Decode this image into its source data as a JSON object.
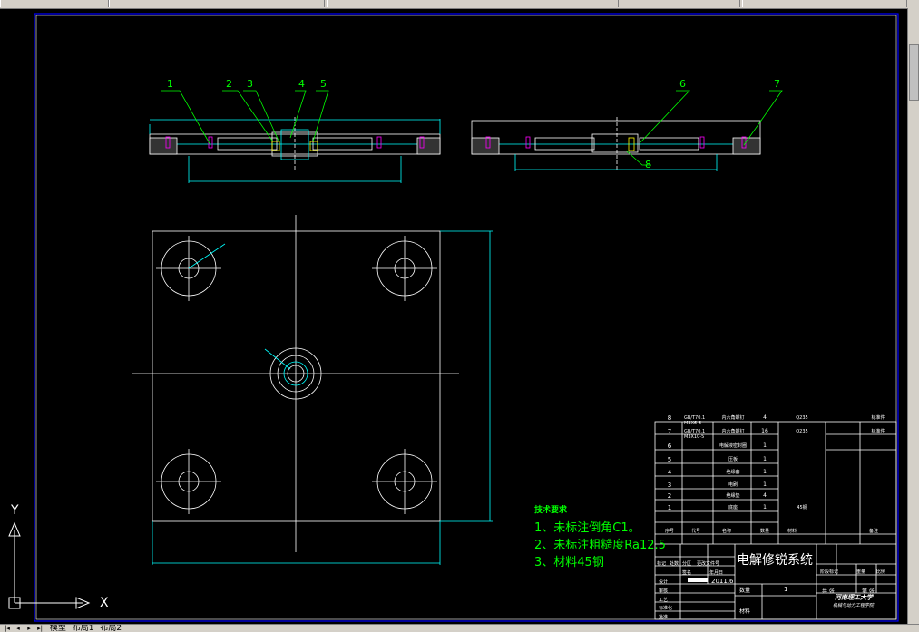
{
  "drawing": {
    "title": "电解修锐系统",
    "school": "河南理工大学",
    "school_sub": "机械与动力工程学院",
    "date": "2011.6",
    "scale_value": "1",
    "tech_requirements": {
      "title": "技术要求",
      "lines": [
        "1、未标注倒角C1。",
        "2、未标注粗糙度Ra12.5",
        "3、材料45钢"
      ]
    },
    "balloons": [
      "1",
      "2",
      "3",
      "4",
      "5",
      "6",
      "7",
      "8"
    ],
    "ucs": {
      "x_label": "X",
      "y_label": "Y"
    }
  },
  "bom": {
    "rows": [
      {
        "no": "8",
        "code": "GB/T70.1 M3X6-8",
        "name": "内六角螺钉",
        "qty": "4",
        "material": "Q235",
        "note": "标准件"
      },
      {
        "no": "7",
        "code": "GB/T70.1 M3X10-5",
        "name": "内六角螺钉",
        "qty": "16",
        "material": "Q235",
        "note": "标准件"
      },
      {
        "no": "6",
        "code": "",
        "name": "电解液密封圈",
        "qty": "1",
        "material": "",
        "note": ""
      },
      {
        "no": "5",
        "code": "",
        "name": "压板",
        "qty": "1",
        "material": "",
        "note": ""
      },
      {
        "no": "4",
        "code": "",
        "name": "绝缘套",
        "qty": "1",
        "material": "",
        "note": ""
      },
      {
        "no": "3",
        "code": "",
        "name": "电刷",
        "qty": "1",
        "material": "",
        "note": ""
      },
      {
        "no": "2",
        "code": "",
        "name": "绝缘垫",
        "qty": "4",
        "material": "",
        "note": ""
      },
      {
        "no": "1",
        "code": "",
        "name": "底座",
        "qty": "1",
        "material": "45钢",
        "note": ""
      }
    ],
    "header": [
      "序号",
      "代号",
      "名称",
      "数量",
      "材料",
      "备注"
    ]
  },
  "titleblock": {
    "labels": [
      "标记",
      "处数",
      "分区",
      "更改文件号",
      "签名",
      "年月日",
      "设计",
      "审核",
      "工艺",
      "标准化",
      "批准",
      "阶段标记",
      "重量",
      "比例",
      "共 张",
      "第 张",
      "数量",
      "材料"
    ]
  },
  "tabs": {
    "model": "模型",
    "layout1": "布局1",
    "layout2": "布局2"
  },
  "colors": {
    "cad_white": "#ffffff",
    "cad_cyan": "#00ffff",
    "cad_green": "#00ff00",
    "cad_red": "#ff0000",
    "cad_magenta": "#ff00ff",
    "cad_yellow": "#ffff00",
    "cad_blue": "#0000ff"
  }
}
